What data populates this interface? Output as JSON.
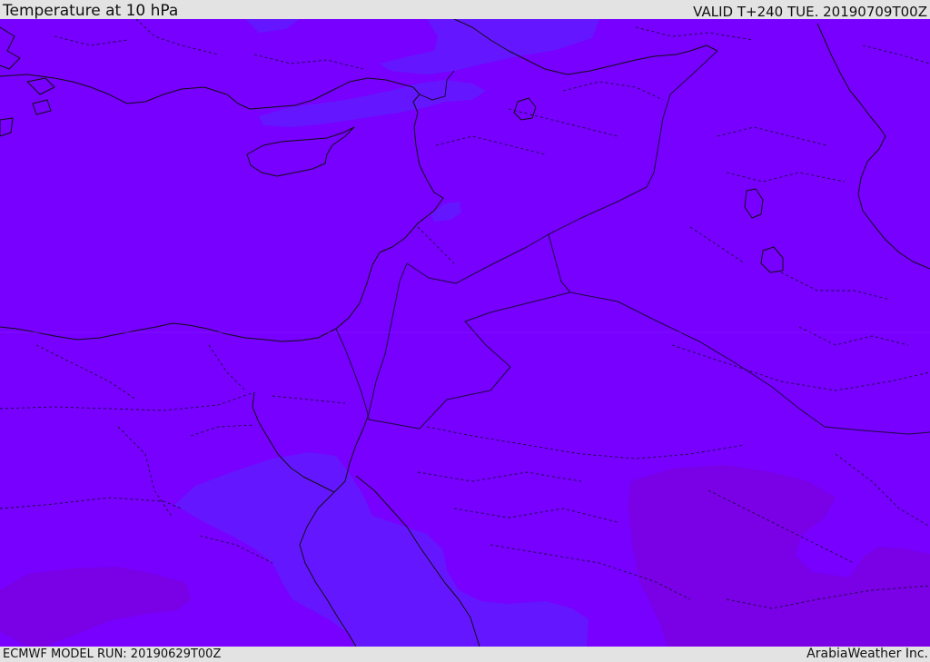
{
  "header": {
    "title": "Temperature at 10 hPa",
    "valid": "VALID T+240 TUE. 20190709T00Z"
  },
  "footer": {
    "model_run": "ECMWF MODEL RUN: 20190629T00Z",
    "credit": "ArabiaWeather Inc."
  },
  "colors": {
    "base_field": "#7700ff",
    "cooler_field": "#6417ff",
    "warmer_field": "#7a00e6",
    "coastline": "#101010",
    "border": "#1c0a3c"
  }
}
